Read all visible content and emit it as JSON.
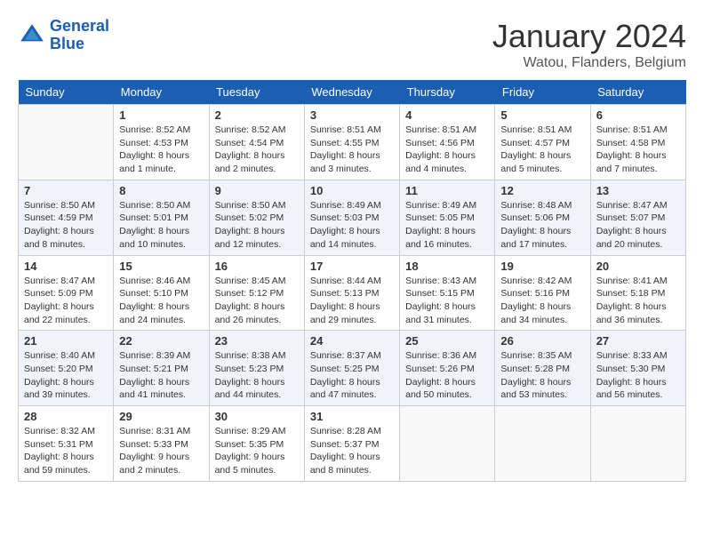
{
  "header": {
    "logo_line1": "General",
    "logo_line2": "Blue",
    "month": "January 2024",
    "location": "Watou, Flanders, Belgium"
  },
  "weekdays": [
    "Sunday",
    "Monday",
    "Tuesday",
    "Wednesday",
    "Thursday",
    "Friday",
    "Saturday"
  ],
  "weeks": [
    [
      {
        "day": "",
        "info": ""
      },
      {
        "day": "1",
        "info": "Sunrise: 8:52 AM\nSunset: 4:53 PM\nDaylight: 8 hours\nand 1 minute."
      },
      {
        "day": "2",
        "info": "Sunrise: 8:52 AM\nSunset: 4:54 PM\nDaylight: 8 hours\nand 2 minutes."
      },
      {
        "day": "3",
        "info": "Sunrise: 8:51 AM\nSunset: 4:55 PM\nDaylight: 8 hours\nand 3 minutes."
      },
      {
        "day": "4",
        "info": "Sunrise: 8:51 AM\nSunset: 4:56 PM\nDaylight: 8 hours\nand 4 minutes."
      },
      {
        "day": "5",
        "info": "Sunrise: 8:51 AM\nSunset: 4:57 PM\nDaylight: 8 hours\nand 5 minutes."
      },
      {
        "day": "6",
        "info": "Sunrise: 8:51 AM\nSunset: 4:58 PM\nDaylight: 8 hours\nand 7 minutes."
      }
    ],
    [
      {
        "day": "7",
        "info": "Sunrise: 8:50 AM\nSunset: 4:59 PM\nDaylight: 8 hours\nand 8 minutes."
      },
      {
        "day": "8",
        "info": "Sunrise: 8:50 AM\nSunset: 5:01 PM\nDaylight: 8 hours\nand 10 minutes."
      },
      {
        "day": "9",
        "info": "Sunrise: 8:50 AM\nSunset: 5:02 PM\nDaylight: 8 hours\nand 12 minutes."
      },
      {
        "day": "10",
        "info": "Sunrise: 8:49 AM\nSunset: 5:03 PM\nDaylight: 8 hours\nand 14 minutes."
      },
      {
        "day": "11",
        "info": "Sunrise: 8:49 AM\nSunset: 5:05 PM\nDaylight: 8 hours\nand 16 minutes."
      },
      {
        "day": "12",
        "info": "Sunrise: 8:48 AM\nSunset: 5:06 PM\nDaylight: 8 hours\nand 17 minutes."
      },
      {
        "day": "13",
        "info": "Sunrise: 8:47 AM\nSunset: 5:07 PM\nDaylight: 8 hours\nand 20 minutes."
      }
    ],
    [
      {
        "day": "14",
        "info": "Sunrise: 8:47 AM\nSunset: 5:09 PM\nDaylight: 8 hours\nand 22 minutes."
      },
      {
        "day": "15",
        "info": "Sunrise: 8:46 AM\nSunset: 5:10 PM\nDaylight: 8 hours\nand 24 minutes."
      },
      {
        "day": "16",
        "info": "Sunrise: 8:45 AM\nSunset: 5:12 PM\nDaylight: 8 hours\nand 26 minutes."
      },
      {
        "day": "17",
        "info": "Sunrise: 8:44 AM\nSunset: 5:13 PM\nDaylight: 8 hours\nand 29 minutes."
      },
      {
        "day": "18",
        "info": "Sunrise: 8:43 AM\nSunset: 5:15 PM\nDaylight: 8 hours\nand 31 minutes."
      },
      {
        "day": "19",
        "info": "Sunrise: 8:42 AM\nSunset: 5:16 PM\nDaylight: 8 hours\nand 34 minutes."
      },
      {
        "day": "20",
        "info": "Sunrise: 8:41 AM\nSunset: 5:18 PM\nDaylight: 8 hours\nand 36 minutes."
      }
    ],
    [
      {
        "day": "21",
        "info": "Sunrise: 8:40 AM\nSunset: 5:20 PM\nDaylight: 8 hours\nand 39 minutes."
      },
      {
        "day": "22",
        "info": "Sunrise: 8:39 AM\nSunset: 5:21 PM\nDaylight: 8 hours\nand 41 minutes."
      },
      {
        "day": "23",
        "info": "Sunrise: 8:38 AM\nSunset: 5:23 PM\nDaylight: 8 hours\nand 44 minutes."
      },
      {
        "day": "24",
        "info": "Sunrise: 8:37 AM\nSunset: 5:25 PM\nDaylight: 8 hours\nand 47 minutes."
      },
      {
        "day": "25",
        "info": "Sunrise: 8:36 AM\nSunset: 5:26 PM\nDaylight: 8 hours\nand 50 minutes."
      },
      {
        "day": "26",
        "info": "Sunrise: 8:35 AM\nSunset: 5:28 PM\nDaylight: 8 hours\nand 53 minutes."
      },
      {
        "day": "27",
        "info": "Sunrise: 8:33 AM\nSunset: 5:30 PM\nDaylight: 8 hours\nand 56 minutes."
      }
    ],
    [
      {
        "day": "28",
        "info": "Sunrise: 8:32 AM\nSunset: 5:31 PM\nDaylight: 8 hours\nand 59 minutes."
      },
      {
        "day": "29",
        "info": "Sunrise: 8:31 AM\nSunset: 5:33 PM\nDaylight: 9 hours\nand 2 minutes."
      },
      {
        "day": "30",
        "info": "Sunrise: 8:29 AM\nSunset: 5:35 PM\nDaylight: 9 hours\nand 5 minutes."
      },
      {
        "day": "31",
        "info": "Sunrise: 8:28 AM\nSunset: 5:37 PM\nDaylight: 9 hours\nand 8 minutes."
      },
      {
        "day": "",
        "info": ""
      },
      {
        "day": "",
        "info": ""
      },
      {
        "day": "",
        "info": ""
      }
    ]
  ]
}
